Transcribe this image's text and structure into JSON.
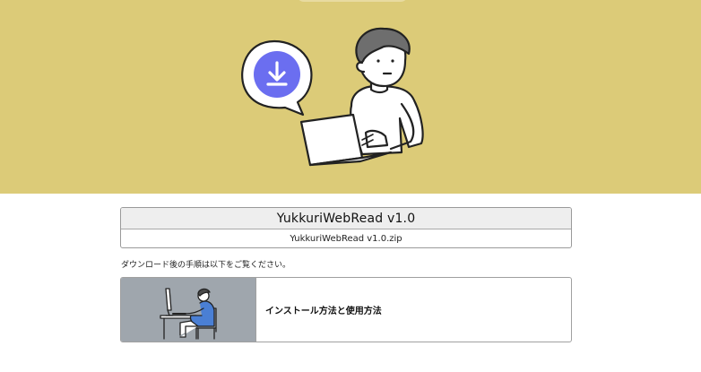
{
  "hero": {
    "background_color": "#dccb78",
    "bubble_icon": "download-icon",
    "bubble_color": "#6b6ef0"
  },
  "download": {
    "title": "YukkuriWebRead v1.0",
    "file_name": "YukkuriWebRead v1.0.zip"
  },
  "note": "ダウンロード後の手順は以下をご覧ください。",
  "guide": {
    "label": "インストール方法と使用方法",
    "thumbnail": "person-at-computer-illustration"
  }
}
